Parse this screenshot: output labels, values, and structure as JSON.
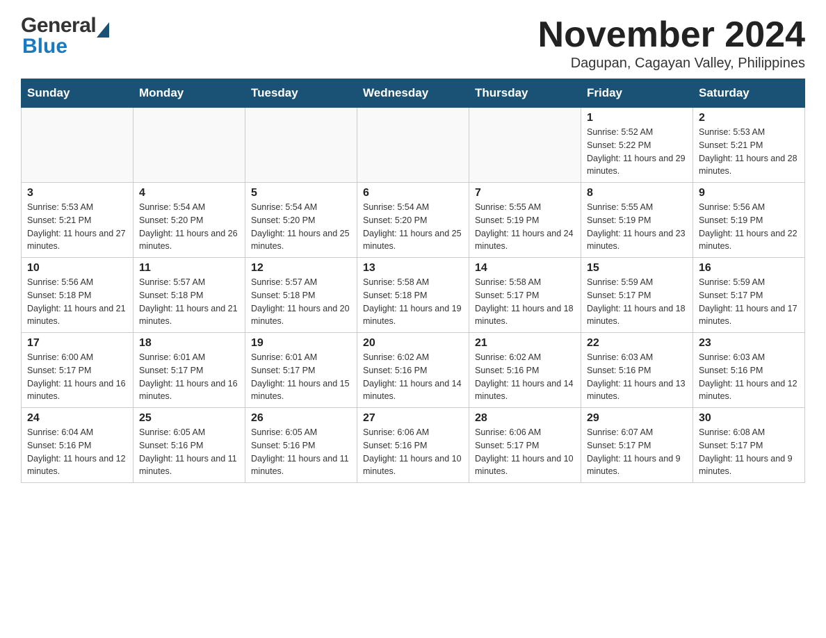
{
  "header": {
    "logo_general": "General",
    "logo_blue": "Blue",
    "month_title": "November 2024",
    "location": "Dagupan, Cagayan Valley, Philippines"
  },
  "calendar": {
    "days_of_week": [
      "Sunday",
      "Monday",
      "Tuesday",
      "Wednesday",
      "Thursday",
      "Friday",
      "Saturday"
    ],
    "weeks": [
      [
        {
          "day": "",
          "info": ""
        },
        {
          "day": "",
          "info": ""
        },
        {
          "day": "",
          "info": ""
        },
        {
          "day": "",
          "info": ""
        },
        {
          "day": "",
          "info": ""
        },
        {
          "day": "1",
          "info": "Sunrise: 5:52 AM\nSunset: 5:22 PM\nDaylight: 11 hours and 29 minutes."
        },
        {
          "day": "2",
          "info": "Sunrise: 5:53 AM\nSunset: 5:21 PM\nDaylight: 11 hours and 28 minutes."
        }
      ],
      [
        {
          "day": "3",
          "info": "Sunrise: 5:53 AM\nSunset: 5:21 PM\nDaylight: 11 hours and 27 minutes."
        },
        {
          "day": "4",
          "info": "Sunrise: 5:54 AM\nSunset: 5:20 PM\nDaylight: 11 hours and 26 minutes."
        },
        {
          "day": "5",
          "info": "Sunrise: 5:54 AM\nSunset: 5:20 PM\nDaylight: 11 hours and 25 minutes."
        },
        {
          "day": "6",
          "info": "Sunrise: 5:54 AM\nSunset: 5:20 PM\nDaylight: 11 hours and 25 minutes."
        },
        {
          "day": "7",
          "info": "Sunrise: 5:55 AM\nSunset: 5:19 PM\nDaylight: 11 hours and 24 minutes."
        },
        {
          "day": "8",
          "info": "Sunrise: 5:55 AM\nSunset: 5:19 PM\nDaylight: 11 hours and 23 minutes."
        },
        {
          "day": "9",
          "info": "Sunrise: 5:56 AM\nSunset: 5:19 PM\nDaylight: 11 hours and 22 minutes."
        }
      ],
      [
        {
          "day": "10",
          "info": "Sunrise: 5:56 AM\nSunset: 5:18 PM\nDaylight: 11 hours and 21 minutes."
        },
        {
          "day": "11",
          "info": "Sunrise: 5:57 AM\nSunset: 5:18 PM\nDaylight: 11 hours and 21 minutes."
        },
        {
          "day": "12",
          "info": "Sunrise: 5:57 AM\nSunset: 5:18 PM\nDaylight: 11 hours and 20 minutes."
        },
        {
          "day": "13",
          "info": "Sunrise: 5:58 AM\nSunset: 5:18 PM\nDaylight: 11 hours and 19 minutes."
        },
        {
          "day": "14",
          "info": "Sunrise: 5:58 AM\nSunset: 5:17 PM\nDaylight: 11 hours and 18 minutes."
        },
        {
          "day": "15",
          "info": "Sunrise: 5:59 AM\nSunset: 5:17 PM\nDaylight: 11 hours and 18 minutes."
        },
        {
          "day": "16",
          "info": "Sunrise: 5:59 AM\nSunset: 5:17 PM\nDaylight: 11 hours and 17 minutes."
        }
      ],
      [
        {
          "day": "17",
          "info": "Sunrise: 6:00 AM\nSunset: 5:17 PM\nDaylight: 11 hours and 16 minutes."
        },
        {
          "day": "18",
          "info": "Sunrise: 6:01 AM\nSunset: 5:17 PM\nDaylight: 11 hours and 16 minutes."
        },
        {
          "day": "19",
          "info": "Sunrise: 6:01 AM\nSunset: 5:17 PM\nDaylight: 11 hours and 15 minutes."
        },
        {
          "day": "20",
          "info": "Sunrise: 6:02 AM\nSunset: 5:16 PM\nDaylight: 11 hours and 14 minutes."
        },
        {
          "day": "21",
          "info": "Sunrise: 6:02 AM\nSunset: 5:16 PM\nDaylight: 11 hours and 14 minutes."
        },
        {
          "day": "22",
          "info": "Sunrise: 6:03 AM\nSunset: 5:16 PM\nDaylight: 11 hours and 13 minutes."
        },
        {
          "day": "23",
          "info": "Sunrise: 6:03 AM\nSunset: 5:16 PM\nDaylight: 11 hours and 12 minutes."
        }
      ],
      [
        {
          "day": "24",
          "info": "Sunrise: 6:04 AM\nSunset: 5:16 PM\nDaylight: 11 hours and 12 minutes."
        },
        {
          "day": "25",
          "info": "Sunrise: 6:05 AM\nSunset: 5:16 PM\nDaylight: 11 hours and 11 minutes."
        },
        {
          "day": "26",
          "info": "Sunrise: 6:05 AM\nSunset: 5:16 PM\nDaylight: 11 hours and 11 minutes."
        },
        {
          "day": "27",
          "info": "Sunrise: 6:06 AM\nSunset: 5:16 PM\nDaylight: 11 hours and 10 minutes."
        },
        {
          "day": "28",
          "info": "Sunrise: 6:06 AM\nSunset: 5:17 PM\nDaylight: 11 hours and 10 minutes."
        },
        {
          "day": "29",
          "info": "Sunrise: 6:07 AM\nSunset: 5:17 PM\nDaylight: 11 hours and 9 minutes."
        },
        {
          "day": "30",
          "info": "Sunrise: 6:08 AM\nSunset: 5:17 PM\nDaylight: 11 hours and 9 minutes."
        }
      ]
    ]
  }
}
